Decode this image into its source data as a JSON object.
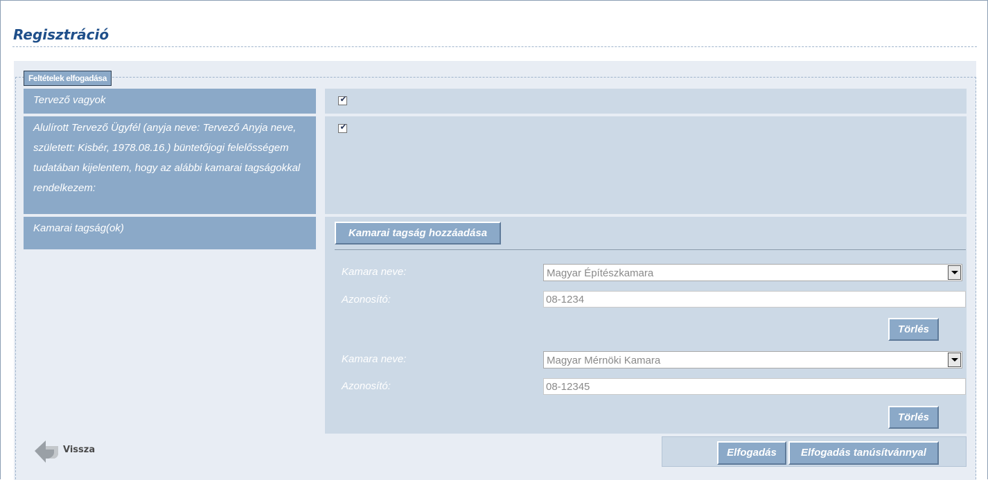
{
  "page": {
    "title": "Regisztráció"
  },
  "fieldset": {
    "legend": "Feltételek elfogadása"
  },
  "rows": {
    "designer": {
      "label": "Tervező vagyok",
      "checked": true
    },
    "declaration": {
      "label": "Alulírott Tervező Ügyfél (anyja neve: Tervező Anyja neve, született: Kisbér, 1978.08.16.) büntetőjogi felelősségem tudatában kijelentem, hogy az alábbi kamarai tagságokkal rendelkezem:",
      "checked": true
    },
    "memberships": {
      "label": "Kamarai tagság(ok)",
      "add_button": "Kamarai tagság hozzáadása",
      "entries": [
        {
          "chamber_label": "Kamara neve:",
          "chamber_value": "Magyar Építészkamara",
          "id_label": "Azonosító:",
          "id_value": "08-1234",
          "delete_button": "Törlés"
        },
        {
          "chamber_label": "Kamara neve:",
          "chamber_value": "Magyar Mérnöki Kamara",
          "id_label": "Azonosító:",
          "id_value": "08-12345",
          "delete_button": "Törlés"
        }
      ]
    }
  },
  "footer": {
    "back_label": "Vissza",
    "accept_button": "Elfogadás",
    "accept_cert_button": "Elfogadás tanúsítvánnyal"
  },
  "colors": {
    "title": "#1f4f8a",
    "label_bg": "#8ba9c8",
    "value_bg": "#ccd9e6",
    "panel_bg": "#e8edf4"
  },
  "icons": {
    "back": "back-arrow-icon",
    "checkbox": "checkmark-icon",
    "dropdown": "chevron-down-icon"
  }
}
